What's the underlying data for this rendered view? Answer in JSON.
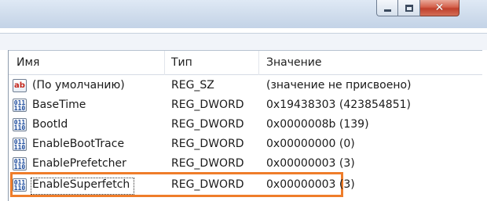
{
  "window": {
    "caption_buttons": {
      "minimize_icon": "minimize-icon",
      "maximize_icon": "maximize-icon",
      "close_icon": "close-icon",
      "close_glyph": "✕"
    }
  },
  "columns": {
    "name": "Имя",
    "type": "Тип",
    "value": "Значение"
  },
  "rows": [
    {
      "icon": "string-value-icon",
      "icon_text": "ab",
      "name": "(По умолчанию)",
      "type": "REG_SZ",
      "value": "(значение не присвоено)"
    },
    {
      "icon": "binary-value-icon",
      "icon_text": "011\n110",
      "name": "BaseTime",
      "type": "REG_DWORD",
      "value": "0x19438303 (423854851)"
    },
    {
      "icon": "binary-value-icon",
      "icon_text": "011\n110",
      "name": "BootId",
      "type": "REG_DWORD",
      "value": "0x0000008b (139)"
    },
    {
      "icon": "binary-value-icon",
      "icon_text": "011\n110",
      "name": "EnableBootTrace",
      "type": "REG_DWORD",
      "value": "0x00000000 (0)"
    },
    {
      "icon": "binary-value-icon",
      "icon_text": "011\n110",
      "name": "EnablePrefetcher",
      "type": "REG_DWORD",
      "value": "0x00000003 (3)"
    },
    {
      "icon": "binary-value-icon",
      "icon_text": "011\n110",
      "name": "EnableSuperfetch",
      "type": "REG_DWORD",
      "value": "0x00000003 (3)",
      "highlighted": true
    }
  ],
  "colors": {
    "highlight_border": "#ef7d2a",
    "close_button": "#c0402c",
    "titlebar": "#cfdcec"
  }
}
